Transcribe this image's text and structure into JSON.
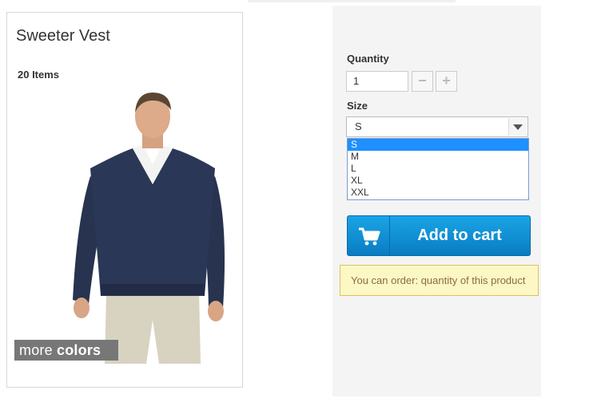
{
  "product": {
    "title": "Sweeter Vest",
    "count_label": "20 Items",
    "more_colors": {
      "light": "more ",
      "bold": "colors"
    }
  },
  "order": {
    "quantity_label": "Quantity",
    "quantity_value": "1",
    "minus_symbol": "−",
    "plus_symbol": "+",
    "size_label": "Size",
    "size_selected": "S",
    "size_options": [
      "S",
      "M",
      "L",
      "XL",
      "XXL"
    ],
    "add_to_cart": "Add to cart",
    "notice": "You can order: quantity of this product"
  },
  "colors": {
    "button": "#0f8fd4",
    "notice_bg": "#fcf8c5",
    "highlight": "#1e90ff"
  },
  "icons": {
    "cart": "shopping-cart-icon",
    "dropdown": "chevron-down-icon"
  }
}
